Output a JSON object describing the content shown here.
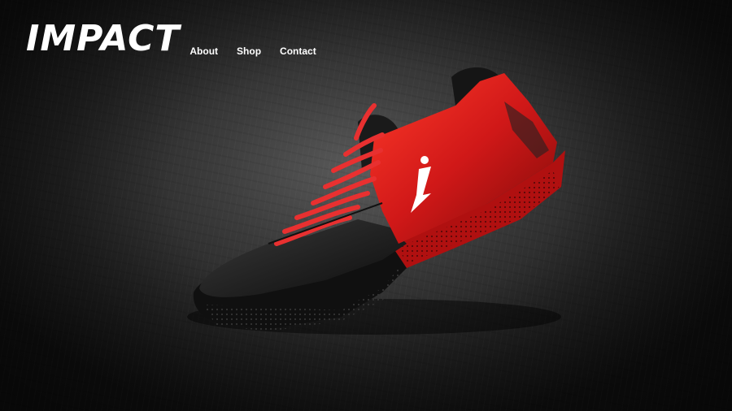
{
  "brand": {
    "logo_text": "IMPACT"
  },
  "nav": {
    "items": [
      {
        "label": "About"
      },
      {
        "label": "Shop"
      },
      {
        "label": "Contact"
      }
    ]
  },
  "hero": {
    "image_subject": "red-and-black-running-shoe",
    "shoe_logo": "i-logo"
  },
  "colors": {
    "accent_red": "#d01818",
    "background": "#2a2a2a",
    "text": "#ffffff"
  }
}
